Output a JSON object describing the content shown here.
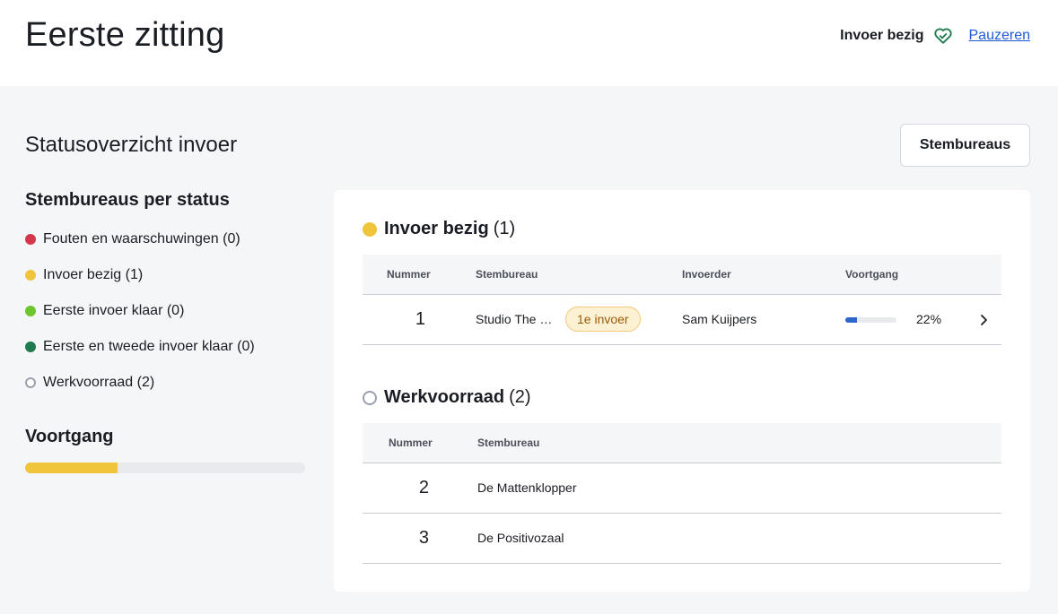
{
  "header": {
    "title": "Eerste zitting",
    "status": "Invoer bezig",
    "pause_label": "Pauzeren"
  },
  "main": {
    "title": "Statusoverzicht invoer",
    "button_label": "Stembureaus"
  },
  "sidebar": {
    "title": "Stembureaus per status",
    "items": [
      {
        "label": "Fouten en waarschuwingen (0)",
        "color": "#d4364b"
      },
      {
        "label": "Invoer bezig (1)",
        "color": "#f0c53b"
      },
      {
        "label": "Eerste invoer klaar (0)",
        "color": "#6cc62c"
      },
      {
        "label": "Eerste en tweede invoer klaar (0)",
        "color": "#1e7b4d"
      },
      {
        "label": "Werkvoorraad (2)",
        "color": "#9aa1ad"
      }
    ],
    "progress_title": "Voortgang",
    "progress_fraction": 0.33
  },
  "groups": {
    "in_progress": {
      "name": "Invoer bezig",
      "count": "(1)",
      "headers": [
        "Nummer",
        "Stembureau",
        "Invoerder",
        "Voortgang"
      ],
      "rows": [
        {
          "number": "1",
          "name": "Studio The R...",
          "badge": "1e invoer",
          "user": "Sam Kuijpers",
          "progress_text": "22%",
          "progress_fraction": 0.22
        }
      ]
    },
    "backlog": {
      "name": "Werkvoorraad",
      "count": "(2)",
      "headers": [
        "Nummer",
        "Stembureau"
      ],
      "rows": [
        {
          "number": "2",
          "name": "De Mattenklopper"
        },
        {
          "number": "3",
          "name": "De Positivozaal"
        }
      ]
    }
  }
}
